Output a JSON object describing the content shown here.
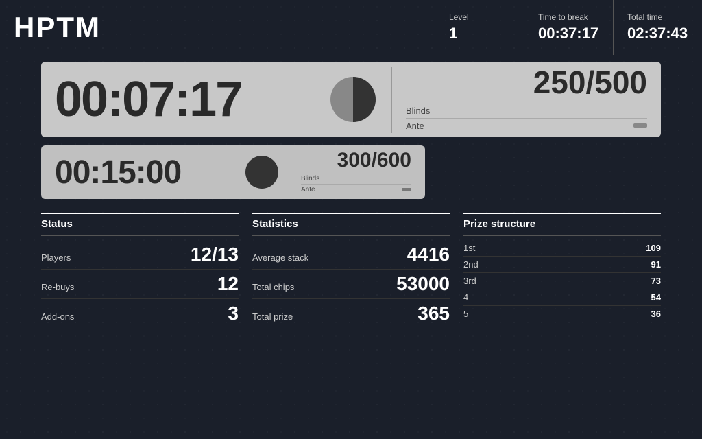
{
  "header": {
    "logo": "HPTM",
    "level_label": "Level",
    "level_value": "1",
    "time_to_break_label": "Time to break",
    "time_to_break_value": "00:37:17",
    "total_time_label": "Total time",
    "total_time_value": "02:37:43"
  },
  "primary_timer": {
    "time": "00:07:17",
    "blinds_label": "Blinds",
    "blinds_value": "250/500",
    "ante_label": "Ante",
    "ante_value": "-",
    "pie_fill": 0.45
  },
  "secondary_timer": {
    "time": "00:15:00",
    "blinds_label": "Blinds",
    "blinds_value": "300/600",
    "ante_label": "Ante",
    "ante_value": "-",
    "pie_fill": 0.0
  },
  "status": {
    "title": "Status",
    "rows": [
      {
        "label": "Players",
        "value": "12/13"
      },
      {
        "label": "Re-buys",
        "value": "12"
      },
      {
        "label": "Add-ons",
        "value": "3"
      }
    ]
  },
  "statistics": {
    "title": "Statistics",
    "rows": [
      {
        "label": "Average stack",
        "value": "4416"
      },
      {
        "label": "Total chips",
        "value": "53000"
      },
      {
        "label": "Total prize",
        "value": "365"
      }
    ]
  },
  "prize_structure": {
    "title": "Prize structure",
    "rows": [
      {
        "label": "1st",
        "value": "109"
      },
      {
        "label": "2nd",
        "value": "91"
      },
      {
        "label": "3rd",
        "value": "73"
      },
      {
        "label": "4",
        "value": "54"
      },
      {
        "label": "5",
        "value": "36"
      }
    ]
  }
}
